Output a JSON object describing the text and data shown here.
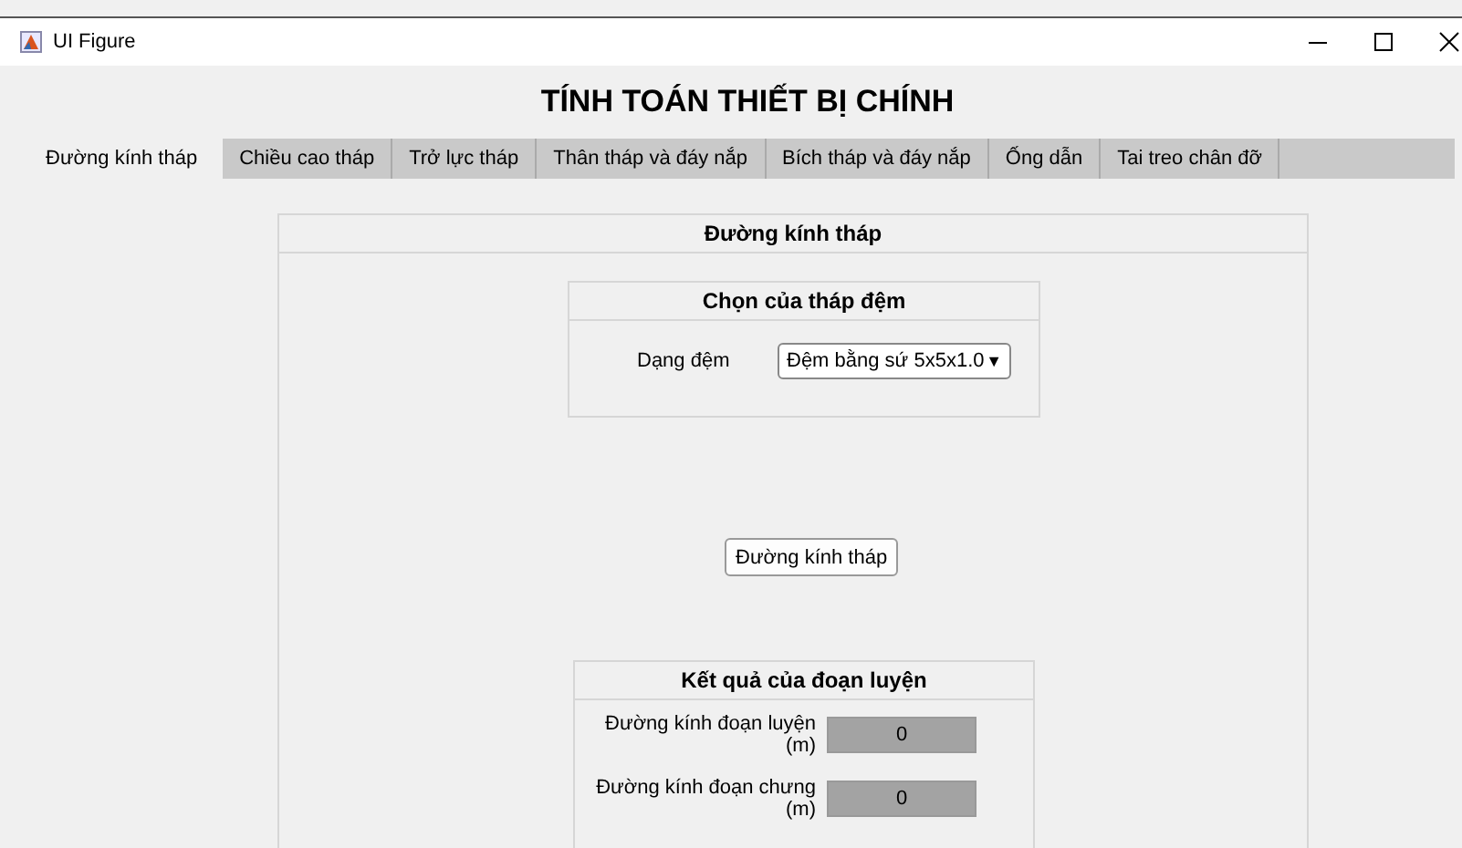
{
  "window": {
    "title": "UI Figure"
  },
  "heading": "TÍNH TOÁN THIẾT BỊ CHÍNH",
  "tabs": [
    {
      "label": "Đường kính tháp",
      "selected": true
    },
    {
      "label": "Chiều cao tháp",
      "selected": false
    },
    {
      "label": "Trở lực tháp",
      "selected": false
    },
    {
      "label": "Thân tháp và đáy nắp",
      "selected": false
    },
    {
      "label": "Bích tháp và đáy nắp",
      "selected": false
    },
    {
      "label": "Ống dẫn",
      "selected": false
    },
    {
      "label": "Tai treo chân đỡ",
      "selected": false
    }
  ],
  "panel": {
    "title": "Đường kính tháp",
    "packing": {
      "title": "Chọn của tháp đệm",
      "label": "Dạng đệm",
      "dropdown": {
        "value": "Đệm bằng sứ 5x5x1.0",
        "arrow": "▼"
      }
    },
    "button": "Đường kính tháp",
    "results": {
      "title": "Kết quả của đoạn luyện",
      "fields": [
        {
          "label": "Đường kính đoạn luyện (m)",
          "value": "0"
        },
        {
          "label": "Đường kính đoạn chưng (m)",
          "value": "0"
        }
      ]
    }
  }
}
